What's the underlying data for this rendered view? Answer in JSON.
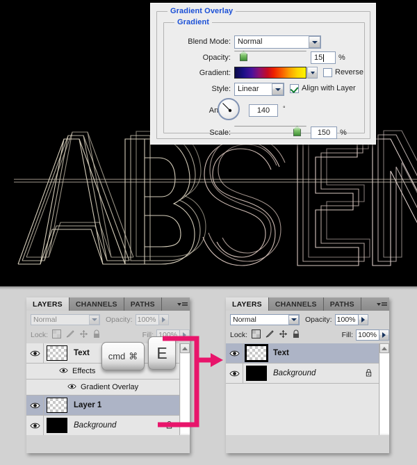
{
  "canvas": {
    "artwork_text": "ABSEN",
    "background_color": "#000000",
    "stroke_color": "#efe4d0"
  },
  "dialog": {
    "title": "Gradient Overlay",
    "group_title": "Gradient",
    "blend_mode": {
      "label": "Blend Mode:",
      "value": "Normal"
    },
    "opacity": {
      "label": "Opacity:",
      "value": "15",
      "unit": "%",
      "slider_percent": 15
    },
    "gradient": {
      "label": "Gradient:",
      "stops": [
        "#0a0a46",
        "#1a0f86",
        "#4a129b",
        "#8a1072",
        "#c50b23",
        "#ee2200",
        "#f85c00",
        "#fba000",
        "#fdd400",
        "#fff400"
      ],
      "reverse_label": "Reverse",
      "reverse_checked": false
    },
    "style": {
      "label": "Style:",
      "value": "Linear",
      "align_label": "Align with Layer",
      "align_checked": true
    },
    "angle": {
      "label": "Angle:",
      "value": "140",
      "unit": "°",
      "degrees": 140
    },
    "scale": {
      "label": "Scale:",
      "value": "150",
      "unit": "%",
      "slider_percent": 94
    }
  },
  "keycaps": {
    "cmd": "cmd",
    "cmd_symbol": "⌘",
    "letter": "E"
  },
  "panel_left": {
    "tabs": [
      "LAYERS",
      "CHANNELS",
      "PATHS"
    ],
    "active_tab": "LAYERS",
    "blend_mode": "Normal",
    "opacity_label": "Opacity:",
    "opacity_value": "100%",
    "lock_label": "Lock:",
    "fill_label": "Fill:",
    "fill_value": "100%",
    "layers": [
      {
        "name": "Text",
        "style": "bold",
        "thumb": "checker",
        "visible": true,
        "selected": false,
        "locked": false
      },
      {
        "name": "Effects",
        "style": "sub",
        "visible": true
      },
      {
        "name": "Gradient Overlay",
        "style": "sub2",
        "visible": true
      },
      {
        "name": "Layer 1",
        "style": "bold",
        "thumb": "checker",
        "visible": true,
        "selected": true,
        "locked": false
      },
      {
        "name": "Background",
        "style": "italic",
        "thumb": "black",
        "visible": true,
        "selected": false,
        "locked": true
      }
    ]
  },
  "panel_right": {
    "tabs": [
      "LAYERS",
      "CHANNELS",
      "PATHS"
    ],
    "active_tab": "LAYERS",
    "blend_mode": "Normal",
    "opacity_label": "Opacity:",
    "opacity_value": "100%",
    "lock_label": "Lock:",
    "fill_label": "Fill:",
    "fill_value": "100%",
    "layers": [
      {
        "name": "Text",
        "style": "bold",
        "thumb": "checker",
        "visible": true,
        "selected": true,
        "locked": false
      },
      {
        "name": "Background",
        "style": "italic",
        "thumb": "black",
        "visible": true,
        "selected": false,
        "locked": true
      }
    ]
  },
  "annotation": {
    "arrow_color": "#e8156b"
  }
}
